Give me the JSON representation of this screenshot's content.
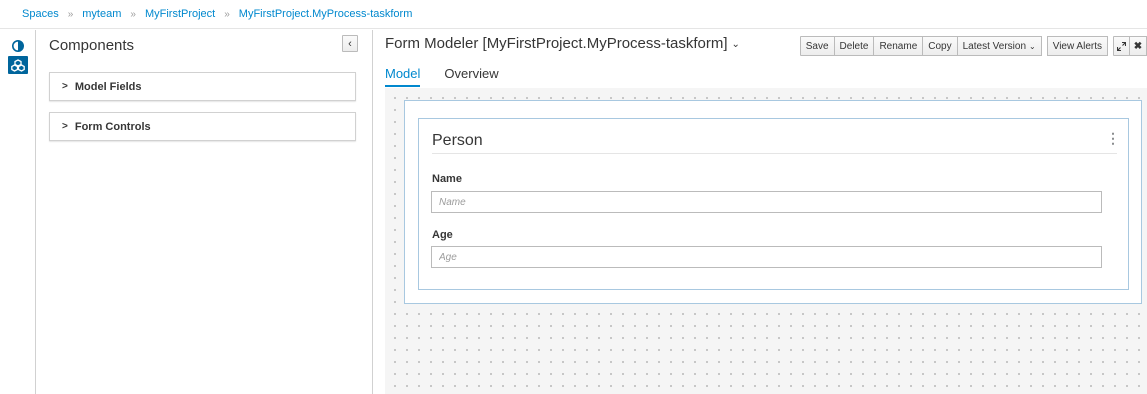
{
  "breadcrumb": {
    "items": [
      "Spaces",
      "myteam",
      "MyFirstProject",
      "MyFirstProject.MyProcess-taskform"
    ],
    "separator": "»"
  },
  "palette": {
    "title": "Components",
    "collapse_icon": "chevron-left-icon",
    "groups": [
      {
        "label": "Model Fields"
      },
      {
        "label": "Form Controls"
      }
    ]
  },
  "editor": {
    "title": "Form Modeler [MyFirstProject.MyProcess-taskform]",
    "toolbar": {
      "save": "Save",
      "delete": "Delete",
      "rename": "Rename",
      "copy": "Copy",
      "latest_version": "Latest Version",
      "view_alerts": "View Alerts"
    },
    "tabs": [
      {
        "label": "Model",
        "active": true
      },
      {
        "label": "Overview",
        "active": false
      }
    ],
    "form": {
      "panel_title": "Person",
      "fields": [
        {
          "label": "Name",
          "placeholder": "Name"
        },
        {
          "label": "Age",
          "placeholder": "Age"
        }
      ]
    }
  },
  "colors": {
    "accent": "#0088ce",
    "icon_active_bg": "#00659c",
    "border": "#d1d1d1"
  }
}
